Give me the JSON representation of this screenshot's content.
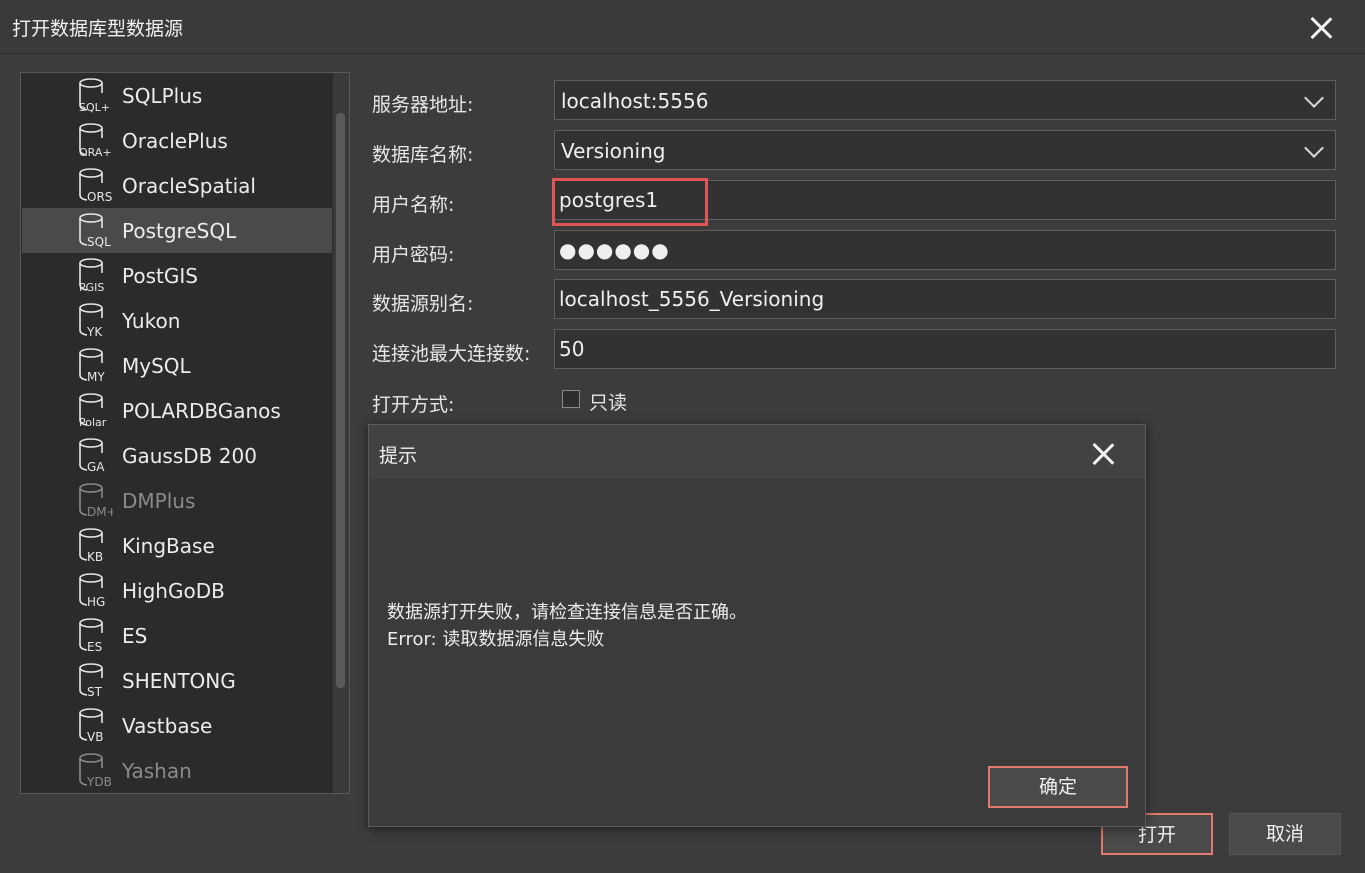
{
  "window": {
    "title": "打开数据库型数据源"
  },
  "datasource_list": {
    "selected_index": 3,
    "items": [
      {
        "label": "SQLPlus",
        "badge": "SQL+",
        "enabled": true
      },
      {
        "label": "OraclePlus",
        "badge": "ORA+",
        "enabled": true
      },
      {
        "label": "OracleSpatial",
        "badge": "ORS",
        "enabled": true
      },
      {
        "label": "PostgreSQL",
        "badge": "SQL",
        "enabled": true
      },
      {
        "label": "PostGIS",
        "badge": "PGIS",
        "enabled": true
      },
      {
        "label": "Yukon",
        "badge": "YK",
        "enabled": true
      },
      {
        "label": "MySQL",
        "badge": "MY",
        "enabled": true
      },
      {
        "label": "POLARDBGanos",
        "badge": "Polar",
        "enabled": true
      },
      {
        "label": "GaussDB 200",
        "badge": "GA",
        "enabled": true
      },
      {
        "label": "DMPlus",
        "badge": "DM+",
        "enabled": false
      },
      {
        "label": "KingBase",
        "badge": "KB",
        "enabled": true
      },
      {
        "label": "HighGoDB",
        "badge": "HG",
        "enabled": true
      },
      {
        "label": "ES",
        "badge": "ES",
        "enabled": true
      },
      {
        "label": "SHENTONG",
        "badge": "ST",
        "enabled": true
      },
      {
        "label": "Vastbase",
        "badge": "VB",
        "enabled": true
      },
      {
        "label": "Yashan",
        "badge": "YDB",
        "enabled": false
      }
    ]
  },
  "form": {
    "server_label": "服务器地址:",
    "server_value": "localhost:5556",
    "database_label": "数据库名称:",
    "database_value": "Versioning",
    "user_label": "用户名称:",
    "user_value": "postgres1",
    "password_label": "用户密码:",
    "password_value": "●●●●●●",
    "alias_label": "数据源别名:",
    "alias_value": "localhost_5556_Versioning",
    "pool_label": "连接池最大连接数:",
    "pool_value": "50",
    "open_mode_label": "打开方式:",
    "readonly_label": "只读",
    "readonly_checked": false
  },
  "buttons": {
    "open": "打开",
    "cancel": "取消"
  },
  "dialog": {
    "title": "提示",
    "message_line1": "数据源打开失败，请检查连接信息是否正确。",
    "message_line2": "Error: 读取数据源信息失败",
    "ok": "确定"
  },
  "colors": {
    "highlight": "#e05555",
    "accent_border": "#e07a6e",
    "background": "#3c3c3c"
  }
}
